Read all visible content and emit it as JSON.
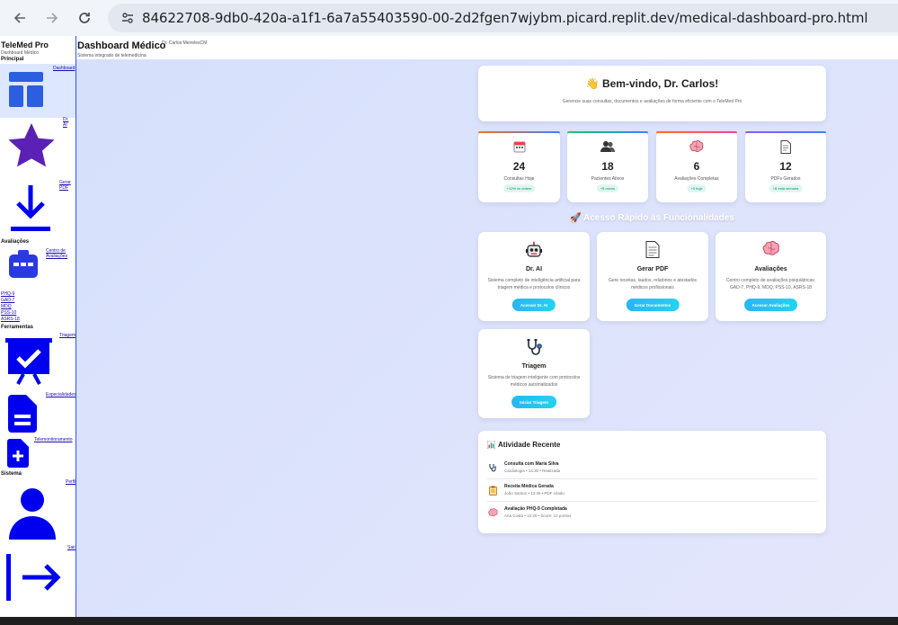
{
  "browser": {
    "url": "84622708-9db0-420a-a1f1-6a7a55403590-00-2d2fgen7wjybm.picard.replit.dev/medical-dashboard-pro.html"
  },
  "sidebar": {
    "brand": "TeleMed Pro",
    "brand_sub": "Dashboard Médico",
    "sections": {
      "principal": "Principal",
      "avaliacoes": "Avaliações",
      "ferramentas": "Ferramentas",
      "sistema": "Sistema"
    },
    "items": {
      "dashboard": "Dashboard",
      "drai_1": "Dr.",
      "drai_2": "AI",
      "gerar_1": "Gerar",
      "gerar_2": "PDF",
      "centro_1": "Centro de",
      "centro_2": "Avaliações",
      "phq9": "PHQ-9",
      "gad7": "GAD-7",
      "mdq": "MDQ",
      "pss10": "PSS-10",
      "asrs18": "ASRS-18",
      "triagem": "Triagem",
      "especialidades": "Especialidades",
      "telemonitoramento": "Telemonitoramento",
      "perfil": "Perfil",
      "sair": "Sair"
    }
  },
  "header": {
    "title": "Dashboard Médico",
    "user": "Dr. Carlos MeirelesCM",
    "subtitle": "Sistema integrado de telemedicina"
  },
  "welcome": {
    "title": "👋 Bem-vindo, Dr. Carlos!",
    "subtitle": "Gerencie suas consultas, documentos e avaliações de forma eficiente com o TeleMed Pro"
  },
  "stats": [
    {
      "icon": "calendar-icon",
      "value": "24",
      "label": "Consultas Hoje",
      "change": "+12% vs ontem",
      "accent": "#f97316"
    },
    {
      "icon": "users-icon",
      "value": "18",
      "label": "Pacientes Ativos",
      "change": "+5 novos",
      "accent": "#22c55e"
    },
    {
      "icon": "brain-icon",
      "value": "6",
      "label": "Avaliações Completas",
      "change": "+3 hoje",
      "accent": "#f97316"
    },
    {
      "icon": "document-icon",
      "value": "12",
      "label": "PDFs Gerados",
      "change": "+8 esta semana",
      "accent": "#8b5cf6"
    }
  ],
  "quick_access": {
    "title": "🚀 Acesso Rápido às Funcionalidades",
    "cards": [
      {
        "icon": "robot-icon",
        "title": "Dr. AI",
        "desc": "Sistema completo de inteligência artificial para triagem médica e protocolos clínicos",
        "button": "Acessar Dr. AI"
      },
      {
        "icon": "document-icon",
        "title": "Gerar PDF",
        "desc": "Gere receitas, laudos, relatórios e atestados médicos profissionais",
        "button": "Gerar Documentos"
      },
      {
        "icon": "brain-icon",
        "title": "Avaliações",
        "desc": "Centro completo de avaliações psiquiátricas: GAD-7, PHQ-9, MDQ, PSS-10, ASRS-18",
        "button": "Acessar Avaliações"
      },
      {
        "icon": "stethoscope-icon",
        "title": "Triagem",
        "desc": "Sistema de triagem inteligente com protocolos médicos automatizados",
        "button": "Iniciar Triagem"
      }
    ]
  },
  "activity": {
    "title": "Atividade Recente",
    "items": [
      {
        "icon": "stethoscope-icon",
        "title": "Consulta com Maria Silva",
        "sub": "Cardiologia • 14:30 • Realizada"
      },
      {
        "icon": "clipboard-icon",
        "title": "Receita Médica Gerada",
        "sub": "João Santos • 13:45 • PDF criado"
      },
      {
        "icon": "brain-icon",
        "title": "Avaliação PHQ-9 Completada",
        "sub": "Ana Costa • 12:20 • Score: 12 pontos"
      }
    ]
  }
}
